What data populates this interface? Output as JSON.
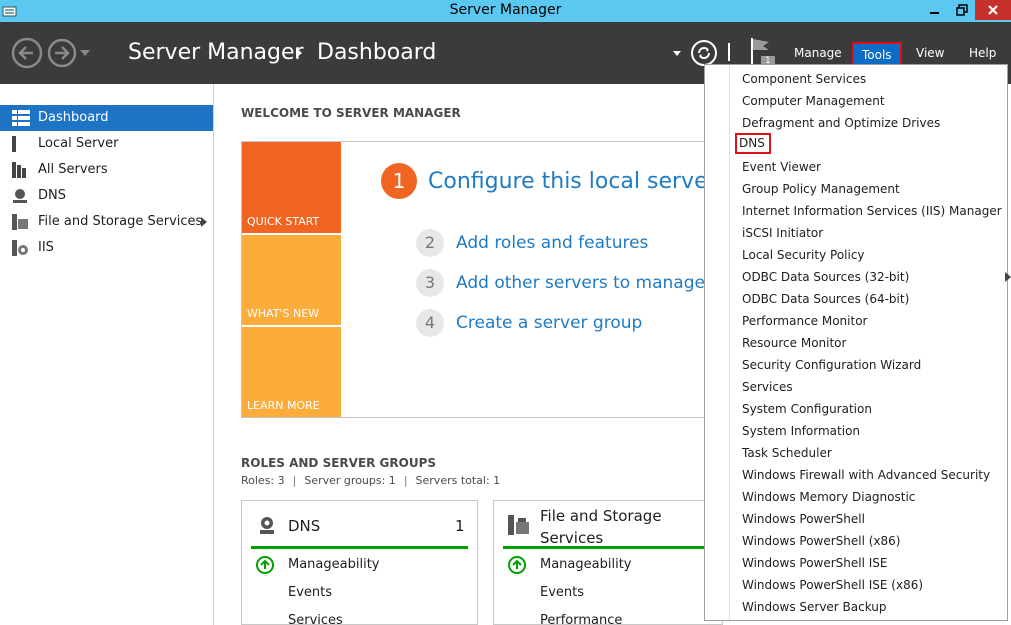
{
  "window": {
    "title": "Server Manager"
  },
  "header": {
    "app_name": "Server Manager",
    "page_name": "Dashboard",
    "flag_count": "1",
    "menu": {
      "manage": "Manage",
      "tools": "Tools",
      "view": "View",
      "help": "Help"
    }
  },
  "sidebar": {
    "items": [
      {
        "label": "Dashboard",
        "icon": "dashboard-icon",
        "active": true
      },
      {
        "label": "Local Server",
        "icon": "local-server-icon"
      },
      {
        "label": "All Servers",
        "icon": "all-servers-icon"
      },
      {
        "label": "DNS",
        "icon": "dns-icon"
      },
      {
        "label": "File and Storage Services",
        "icon": "file-storage-icon"
      },
      {
        "label": "IIS",
        "icon": "iis-icon"
      }
    ]
  },
  "welcome": {
    "title": "WELCOME TO SERVER MANAGER",
    "tiles": {
      "quick_start": "QUICK START",
      "whats_new": "WHAT'S NEW",
      "learn_more": "LEARN MORE"
    },
    "steps": [
      {
        "num": "1",
        "text": "Configure this local server"
      },
      {
        "num": "2",
        "text": "Add roles and features"
      },
      {
        "num": "3",
        "text": "Add other servers to manage"
      },
      {
        "num": "4",
        "text": "Create a server group"
      }
    ]
  },
  "roles": {
    "title": "ROLES AND SERVER GROUPS",
    "stats": {
      "roles": "Roles: 3",
      "groups": "Server groups: 1",
      "servers": "Servers total: 1",
      "sep": "|"
    },
    "cards": [
      {
        "title": "DNS",
        "count": "1",
        "rows": [
          "Manageability",
          "Events",
          "Services"
        ]
      },
      {
        "title_line1": "File and Storage",
        "title_line2": "Services",
        "rows": [
          "Manageability",
          "Events",
          "Performance"
        ]
      }
    ]
  },
  "tools_menu": {
    "items": [
      "Component Services",
      "Computer Management",
      "Defragment and Optimize Drives",
      "DNS",
      "Event Viewer",
      "Group Policy Management",
      "Internet Information Services (IIS) Manager",
      "iSCSI Initiator",
      "Local Security Policy",
      "ODBC Data Sources (32-bit)",
      "ODBC Data Sources (64-bit)",
      "Performance Monitor",
      "Resource Monitor",
      "Security Configuration Wizard",
      "Services",
      "System Configuration",
      "System Information",
      "Task Scheduler",
      "Windows Firewall with Advanced Security",
      "Windows Memory Diagnostic",
      "Windows PowerShell",
      "Windows PowerShell (x86)",
      "Windows PowerShell ISE",
      "Windows PowerShell ISE (x86)",
      "Windows Server Backup"
    ],
    "highlighted": "DNS"
  },
  "colors": {
    "title_bar": "#5ac8f0",
    "header": "#3b3b3b",
    "accent_blue": "#1d74c4",
    "quick_start": "#f16522",
    "tile_yellow": "#fbac3a",
    "link_blue": "#1e7bc4",
    "highlight_red": "#e0101a",
    "status_green": "#00a000"
  }
}
